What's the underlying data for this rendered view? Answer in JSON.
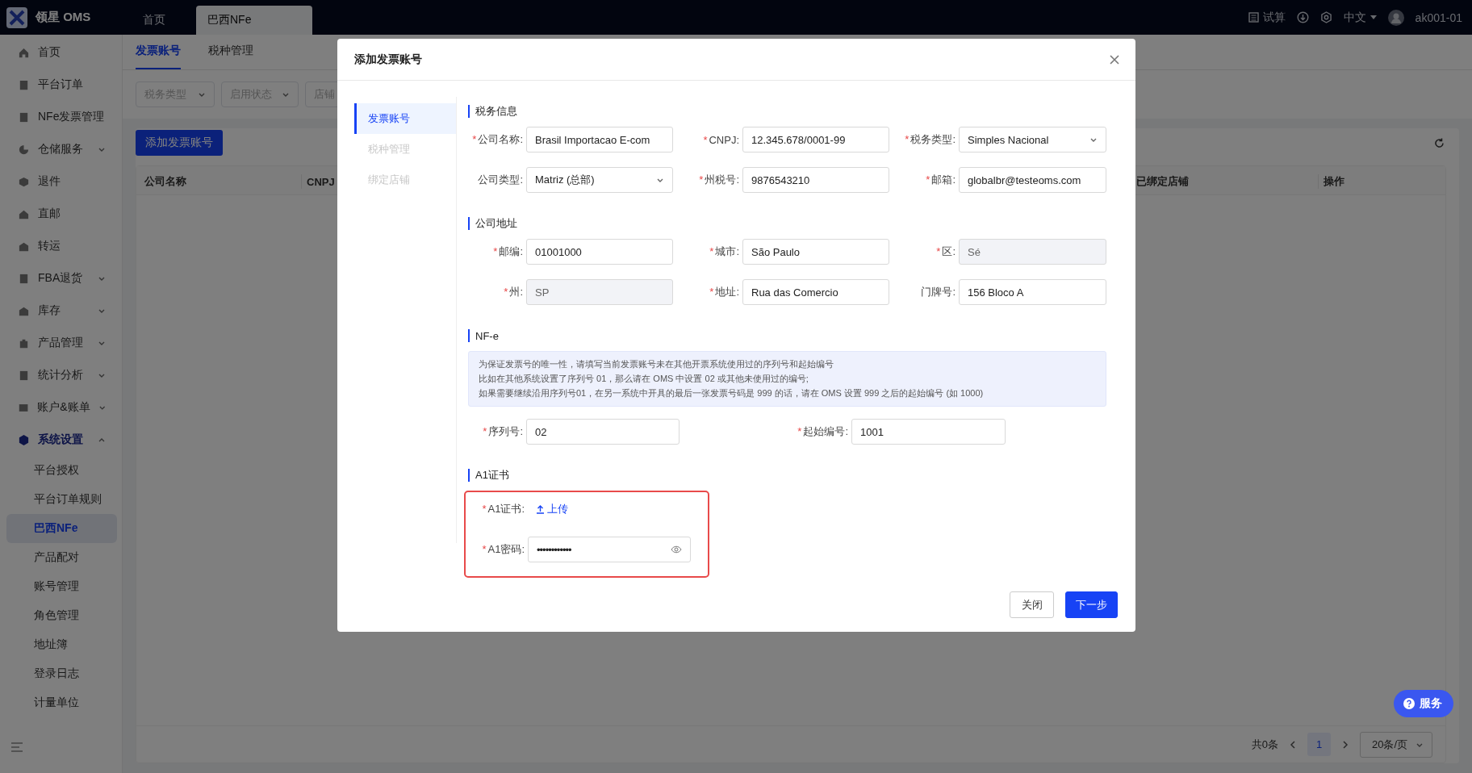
{
  "app": {
    "logo_text": "领星 OMS"
  },
  "top_tabs": [
    {
      "label": "首页",
      "selected": false
    },
    {
      "label": "巴西NFe",
      "selected": true
    }
  ],
  "header_actions": {
    "trial": "试算",
    "language": "中文",
    "user": "ak001-01"
  },
  "sidebar": {
    "items": [
      {
        "kind": "link",
        "label": "首页"
      },
      {
        "kind": "link",
        "label": "平台订单"
      },
      {
        "kind": "link",
        "label": "NFe发票管理"
      },
      {
        "kind": "group",
        "label": "仓储服务",
        "expanded": false
      },
      {
        "kind": "link",
        "label": "退件"
      },
      {
        "kind": "link",
        "label": "直邮"
      },
      {
        "kind": "link",
        "label": "转运"
      },
      {
        "kind": "group",
        "label": "FBA退货",
        "expanded": false
      },
      {
        "kind": "group",
        "label": "库存",
        "expanded": false
      },
      {
        "kind": "group",
        "label": "产品管理",
        "expanded": false
      },
      {
        "kind": "group",
        "label": "统计分析",
        "expanded": false
      },
      {
        "kind": "group",
        "label": "账户&账单",
        "expanded": false
      },
      {
        "kind": "group",
        "label": "系统设置",
        "expanded": true,
        "children": [
          {
            "label": "平台授权",
            "selected": false
          },
          {
            "label": "平台订单规则",
            "selected": false
          },
          {
            "label": "巴西NFe",
            "selected": true
          },
          {
            "label": "产品配对",
            "selected": false
          },
          {
            "label": "账号管理",
            "selected": false
          },
          {
            "label": "角色管理",
            "selected": false
          },
          {
            "label": "地址簿",
            "selected": false
          },
          {
            "label": "登录日志",
            "selected": false
          },
          {
            "label": "计量单位",
            "selected": false
          }
        ]
      }
    ]
  },
  "page": {
    "tabs": [
      {
        "label": "发票账号",
        "selected": true
      },
      {
        "label": "税种管理",
        "selected": false
      }
    ],
    "filters": [
      {
        "placeholder": "税务类型"
      },
      {
        "placeholder": "启用状态"
      },
      {
        "placeholder": "店铺"
      }
    ],
    "add_button": "添加发票账号",
    "table": {
      "columns": [
        "公司名称",
        "CNPJ",
        "已绑定店铺",
        "操作"
      ]
    },
    "pagination": {
      "total": "共0条",
      "pages": [
        {
          "label": "1",
          "selected": true
        }
      ],
      "page_size": "20条/页"
    }
  },
  "service_button": "服务",
  "modal": {
    "title": "添加发票账号",
    "required_mark": "*",
    "steps": [
      {
        "label": "发票账号",
        "selected": true,
        "disabled": false
      },
      {
        "label": "税种管理",
        "selected": false,
        "disabled": true
      },
      {
        "label": "绑定店铺",
        "selected": false,
        "disabled": true
      }
    ],
    "sections": [
      {
        "kind": "grid",
        "title": "税务信息",
        "fields": [
          {
            "kind": "text",
            "label": "公司名称:",
            "required": true,
            "value": "Brasil Importacao E-com"
          },
          {
            "kind": "text",
            "label": "CNPJ:",
            "required": true,
            "value": "12.345.678/0001-99"
          },
          {
            "kind": "select",
            "label": "税务类型:",
            "required": true,
            "value": "Simples Nacional"
          },
          {
            "kind": "select",
            "label": "公司类型:",
            "required": false,
            "value": "Matriz (总部)"
          },
          {
            "kind": "text",
            "label": "州税号:",
            "required": true,
            "value": "9876543210"
          },
          {
            "kind": "text",
            "label": "邮箱:",
            "required": true,
            "value": "globalbr@testeoms.com"
          }
        ]
      },
      {
        "kind": "grid",
        "title": "公司地址",
        "fields": [
          {
            "kind": "text",
            "label": "邮编:",
            "required": true,
            "value": "01001000"
          },
          {
            "kind": "text",
            "label": "城市:",
            "required": true,
            "value": "São Paulo"
          },
          {
            "kind": "readonly",
            "label": "区:",
            "required": true,
            "value": "Sé"
          },
          {
            "kind": "readonly",
            "label": "州:",
            "required": true,
            "value": "SP"
          },
          {
            "kind": "text",
            "label": "地址:",
            "required": true,
            "value": "Rua das Comercio"
          },
          {
            "kind": "text",
            "label": "门牌号:",
            "required": false,
            "value": "156 Bloco A"
          }
        ]
      },
      {
        "kind": "nfe",
        "title": "NF-e",
        "notice": [
          "为保证发票号的唯一性，请填写当前发票账号未在其他开票系统使用过的序列号和起始编号",
          "比如在其他系统设置了序列号 01，那么请在 OMS 中设置 02 或其他未使用过的编号;",
          "如果需要继续沿用序列号01，在另一系统中开具的最后一张发票号码是 999 的话，请在 OMS 设置 999 之后的起始编号 (如 1000)"
        ],
        "fields": [
          {
            "kind": "text",
            "label": "序列号:",
            "required": true,
            "value": "02"
          },
          {
            "kind": "text",
            "label": "起始编号:",
            "required": true,
            "value": "1001"
          }
        ]
      },
      {
        "kind": "certificate",
        "title": "A1证书",
        "highlighted": true,
        "fields": [
          {
            "kind": "upload",
            "label": "A1证书:",
            "required": true,
            "value": "上传"
          },
          {
            "kind": "password",
            "label": "A1密码:",
            "required": true,
            "value": "••••••••••••"
          }
        ]
      }
    ],
    "buttons": [
      {
        "kind": "default",
        "label": "关闭"
      },
      {
        "kind": "primary",
        "label": "下一步"
      }
    ]
  }
}
